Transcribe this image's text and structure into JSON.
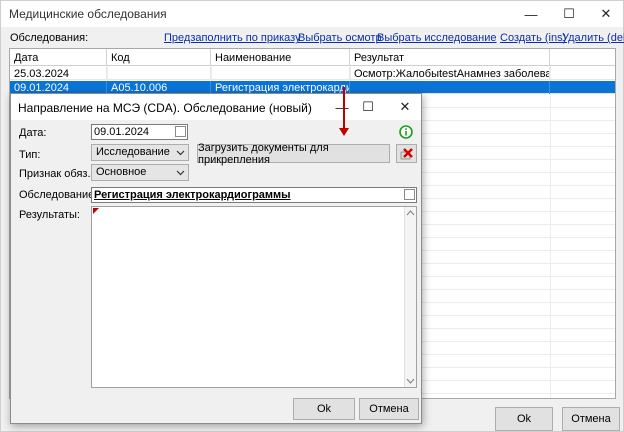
{
  "window": {
    "title": "Медицинские обследования",
    "minimize_glyph": "—",
    "maximize_glyph": "☐",
    "close_glyph": "✕"
  },
  "toolbar": {
    "label": "Обследования:",
    "links": {
      "prefill": "Предзаполнить по приказу",
      "select_exam": "Выбрать осмотр",
      "select_study": "Выбрать исследование",
      "create": "Создать (ins)",
      "delete": "Удалить (del)"
    }
  },
  "grid": {
    "columns": [
      "Дата",
      "Код",
      "Наименование",
      "Результат"
    ],
    "rows": [
      {
        "date": "25.03.2024",
        "code": "",
        "name": "",
        "result": "Осмотр:ЖалобыtestАнамнез заболеванияte..."
      },
      {
        "date": "09.01.2024",
        "code": "A05.10.006",
        "name": "Регистрация электрокардиог...",
        "result": ""
      }
    ],
    "selected_row": 1
  },
  "buttons": {
    "ok": "Ok",
    "cancel": "Отмена"
  },
  "dialog": {
    "title": "Направление на МСЭ (CDA). Обследование (новый)",
    "minimize_glyph": "—",
    "maximize_glyph": "☐",
    "close_glyph": "✕",
    "date_label": "Дата:",
    "date_value": "09.01.2024",
    "type_label": "Тип:",
    "type_value": "Исследование",
    "upload_button": "Загрузить документы для прикрепления",
    "mandatory_label": "Признак обяз.:",
    "mandatory_value": "Основное",
    "study_label": "Обследование:",
    "study_value": "Регистрация электрокардиограммы",
    "results_label": "Результаты:",
    "results_value": "",
    "ok_button": "Ok",
    "cancel_button": "Отмена"
  },
  "colors": {
    "selection": "#0a74d6",
    "link": "#0a2fa8",
    "info_icon": "#1a9c1a",
    "required_marker": "#c00000"
  },
  "icons": {
    "info": "info-circle-icon",
    "clear": "red-x-clear-icon",
    "dropdown": "chevron-down-icon"
  }
}
